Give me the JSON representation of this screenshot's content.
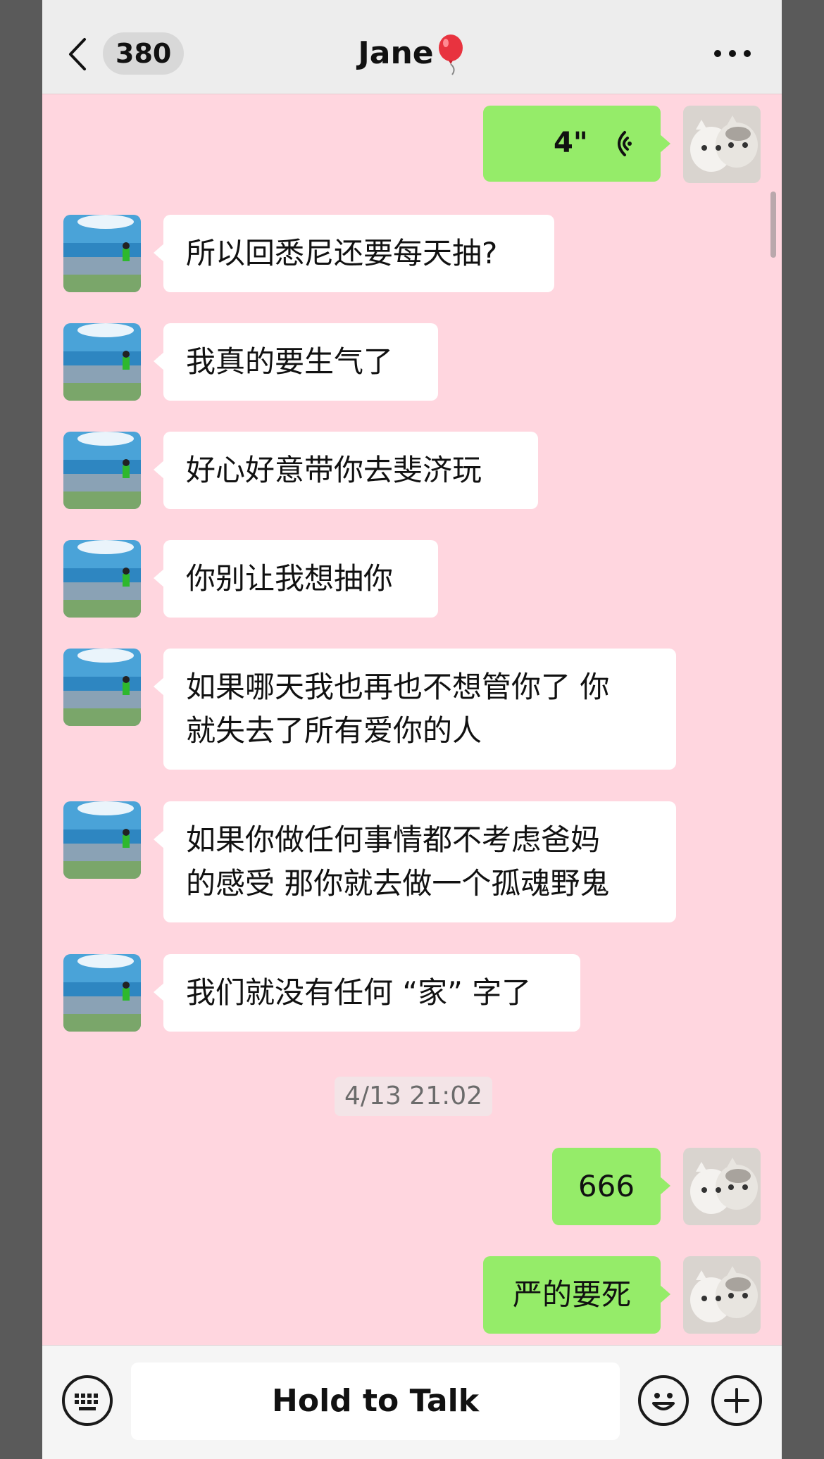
{
  "header": {
    "back_icon": "chevron-left-icon",
    "unread_count": "380",
    "title": "Jane",
    "title_icon": "balloon-icon",
    "more_icon": "more-dots-icon"
  },
  "messages": {
    "voice": {
      "duration": "4\"",
      "icon": "voice-wave-icon"
    },
    "in_1": "所以回悉尼还要每天抽?",
    "in_2": "我真的要生气了",
    "in_3": "好心好意带你去斐济玩",
    "in_4": "你别让我想抽你",
    "in_5_line1": "如果哪天我也再也不想管你了 你",
    "in_5_line2": "就失去了所有爱你的人",
    "in_6_line1": "如果你做任何事情都不考虑爸妈",
    "in_6_line2": "的感受 那你就去做一个孤魂野鬼",
    "in_7": "我们就没有任何 “家” 字了",
    "timestamp": "4/13 21:02",
    "out_1": "666",
    "out_2": "严的要死"
  },
  "input_bar": {
    "keyboard_icon": "keyboard-icon",
    "hold_to_talk": "Hold to Talk",
    "emoji_icon": "emoji-icon",
    "plus_icon": "plus-icon"
  },
  "colors": {
    "chat_background": "#ffd6df",
    "outgoing_bubble": "#95ec69",
    "incoming_bubble": "#ffffff",
    "header_background": "#ededed"
  }
}
